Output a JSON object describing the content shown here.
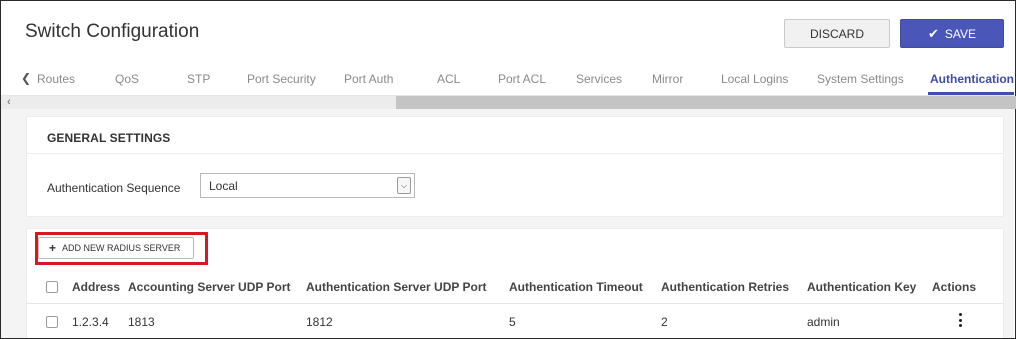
{
  "header": {
    "title": "Switch Configuration",
    "discard_label": "DISCARD",
    "save_label": "SAVE",
    "save_icon": "✔"
  },
  "tabs": {
    "items": [
      {
        "label": "Routes",
        "active": false
      },
      {
        "label": "QoS",
        "active": false
      },
      {
        "label": "STP",
        "active": false
      },
      {
        "label": "Port Security",
        "active": false
      },
      {
        "label": "Port Auth",
        "active": false
      },
      {
        "label": "ACL",
        "active": false
      },
      {
        "label": "Port ACL",
        "active": false
      },
      {
        "label": "Services",
        "active": false
      },
      {
        "label": "Mirror",
        "active": false
      },
      {
        "label": "Local Logins",
        "active": false
      },
      {
        "label": "System Settings",
        "active": false
      },
      {
        "label": "Authentication",
        "active": true
      }
    ]
  },
  "general": {
    "title": "GENERAL SETTINGS",
    "auth_sequence_label": "Authentication Sequence",
    "auth_sequence_value": "Local"
  },
  "radius": {
    "add_button_label": "ADD NEW RADIUS SERVER",
    "columns": [
      "Address",
      "Accounting Server UDP Port",
      "Authentication Server UDP Port",
      "Authentication Timeout",
      "Authentication Retries",
      "Authentication Key",
      "Actions"
    ],
    "rows": [
      {
        "address": "1.2.3.4",
        "accounting_port": "1813",
        "auth_port": "1812",
        "timeout": "5",
        "retries": "2",
        "key": "admin"
      }
    ]
  },
  "colors": {
    "accent": "#3d4db0",
    "save_button": "#4a57b8",
    "highlight": "#d8181c"
  }
}
